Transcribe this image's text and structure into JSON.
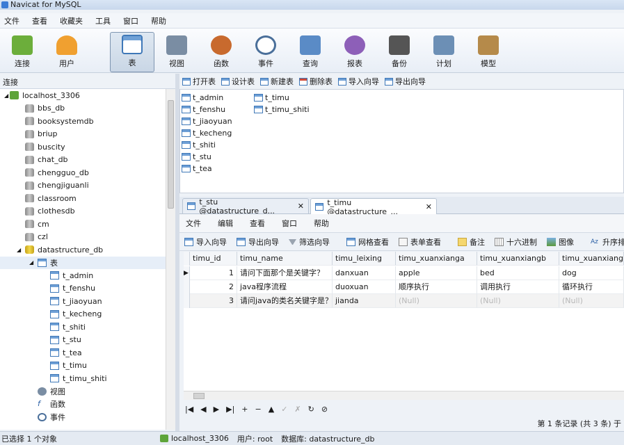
{
  "window": {
    "title": "Navicat for MySQL"
  },
  "menu": [
    "文件",
    "查看",
    "收藏夹",
    "工具",
    "窗口",
    "帮助"
  ],
  "toolbar": [
    {
      "label": "连接",
      "icon": "plug-icon",
      "color": "#6cae3b"
    },
    {
      "label": "用户",
      "icon": "user-icon",
      "color": "#f0a030"
    },
    {
      "label": "表",
      "icon": "table-icon",
      "color": "#3f78b8",
      "active": true
    },
    {
      "label": "视图",
      "icon": "view-icon",
      "color": "#7a8da3"
    },
    {
      "label": "函数",
      "icon": "function-icon",
      "color": "#c86a2e"
    },
    {
      "label": "事件",
      "icon": "clock-icon",
      "color": "#4a6f9a"
    },
    {
      "label": "查询",
      "icon": "query-icon",
      "color": "#5a8bc6"
    },
    {
      "label": "报表",
      "icon": "report-icon",
      "color": "#8d5fb8"
    },
    {
      "label": "备份",
      "icon": "backup-icon",
      "color": "#555555"
    },
    {
      "label": "计划",
      "icon": "schedule-icon",
      "color": "#6c8fb5"
    },
    {
      "label": "模型",
      "icon": "model-icon",
      "color": "#b58a4a"
    }
  ],
  "left_header": "连接",
  "tree": {
    "connection": "localhost_3306",
    "databases": [
      "bbs_db",
      "booksystemdb",
      "briup",
      "buscity",
      "chat_db",
      "chengguo_db",
      "chengjiguanli",
      "classroom",
      "clothesdb",
      "cm",
      "czl"
    ],
    "open_db": "datastructure_db",
    "tables_label": "表",
    "tables": [
      "t_admin",
      "t_fenshu",
      "t_jiaoyuan",
      "t_kecheng",
      "t_shiti",
      "t_stu",
      "t_tea",
      "t_timu",
      "t_timu_shiti"
    ],
    "extra": [
      "视图",
      "函数",
      "事件"
    ]
  },
  "object_toolbar": [
    "打开表",
    "设计表",
    "新建表",
    "删除表",
    "导入向导",
    "导出向导"
  ],
  "object_list_col1": [
    "t_admin",
    "t_fenshu",
    "t_jiaoyuan",
    "t_kecheng",
    "t_shiti",
    "t_stu",
    "t_tea"
  ],
  "object_list_col2": [
    "t_timu",
    "t_timu_shiti"
  ],
  "tabs": [
    {
      "label": "t_stu @datastructure_d...",
      "close": "✕"
    },
    {
      "label": "t_timu @datastructure_...",
      "close": "✕",
      "active": true
    }
  ],
  "inner_menu": [
    "文件",
    "编辑",
    "查看",
    "窗口",
    "帮助"
  ],
  "grid_toolbar": [
    "导入向导",
    "导出向导",
    "筛选向导",
    "网格查看",
    "表单查看",
    "备注",
    "十六进制",
    "图像",
    "升序排序"
  ],
  "grid": {
    "columns": [
      "timu_id",
      "timu_name",
      "timu_leixing",
      "timu_xuanxianga",
      "timu_xuanxiangb",
      "timu_xuanxiangc"
    ],
    "rows": [
      [
        "1",
        "请问下面那个是关键字？",
        "danxuan",
        "apple",
        "bed",
        "dog"
      ],
      [
        "2",
        "java程序流程",
        "duoxuan",
        "顺序执行",
        "调用执行",
        "循环执行"
      ],
      [
        "3",
        "请问java的类名关键字是？",
        "jianda",
        "(Null)",
        "(Null)",
        "(Null)"
      ]
    ]
  },
  "nav": [
    "|◀",
    "◀",
    "▶",
    "▶|",
    "+",
    "−",
    "▲",
    "✓",
    "✗",
    "↻",
    "⊘"
  ],
  "record_status": "第 1 条记录 (共 3 条) 于",
  "status": {
    "left": "已选择 1 个对象",
    "connection": "localhost_3306",
    "user": "用户: root",
    "database": "数据库: datastructure_db"
  }
}
